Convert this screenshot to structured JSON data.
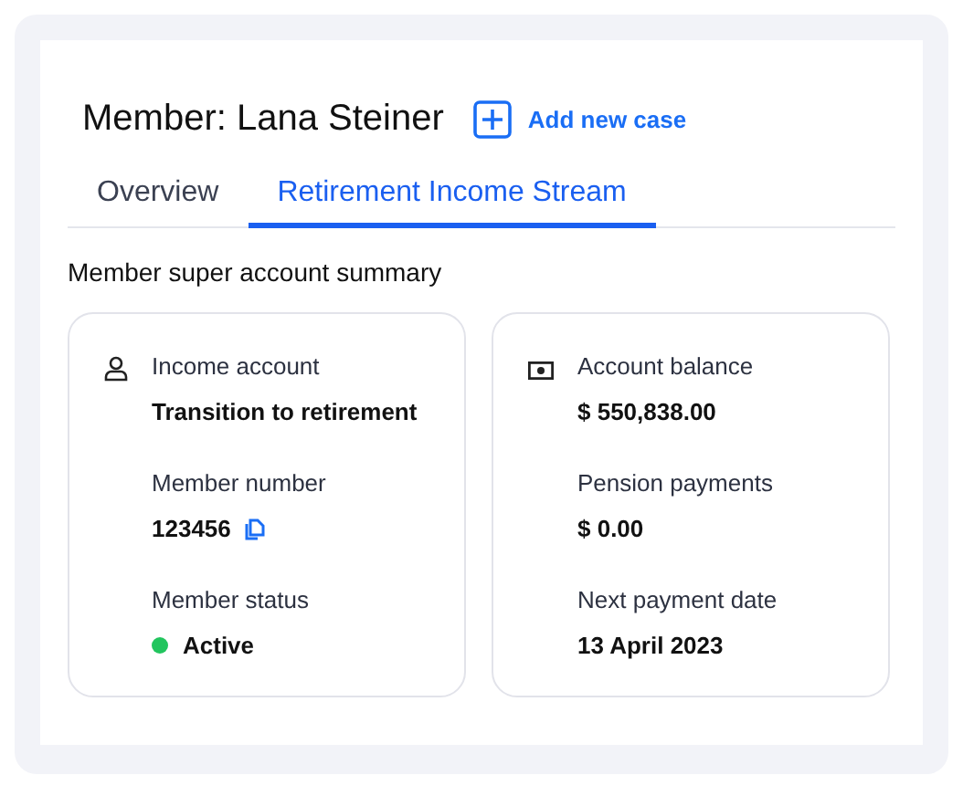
{
  "header": {
    "title": "Member: Lana Steiner",
    "action": "Add new case"
  },
  "tabs": [
    {
      "label": "Overview",
      "selected": false
    },
    {
      "label": "Retirement Income Stream",
      "selected": true
    }
  ],
  "section_title": "Member super account summary",
  "cards": [
    {
      "kind": "person",
      "fields": [
        {
          "kind": "text",
          "label": "Income account",
          "value": "Transition to retirement"
        },
        {
          "kind": "copy",
          "label": "Member number",
          "value": "123456"
        },
        {
          "kind": "status",
          "label": "Member status",
          "value": "Active",
          "color": "#22c55e"
        }
      ]
    },
    {
      "kind": "cash",
      "fields": [
        {
          "kind": "text",
          "label": "Account balance",
          "value": "$ 550,838.00"
        },
        {
          "kind": "text",
          "label": "Pension payments",
          "value": "$ 0.00"
        },
        {
          "kind": "text",
          "label": "Next payment date",
          "value": "13 April 2023"
        }
      ]
    }
  ]
}
